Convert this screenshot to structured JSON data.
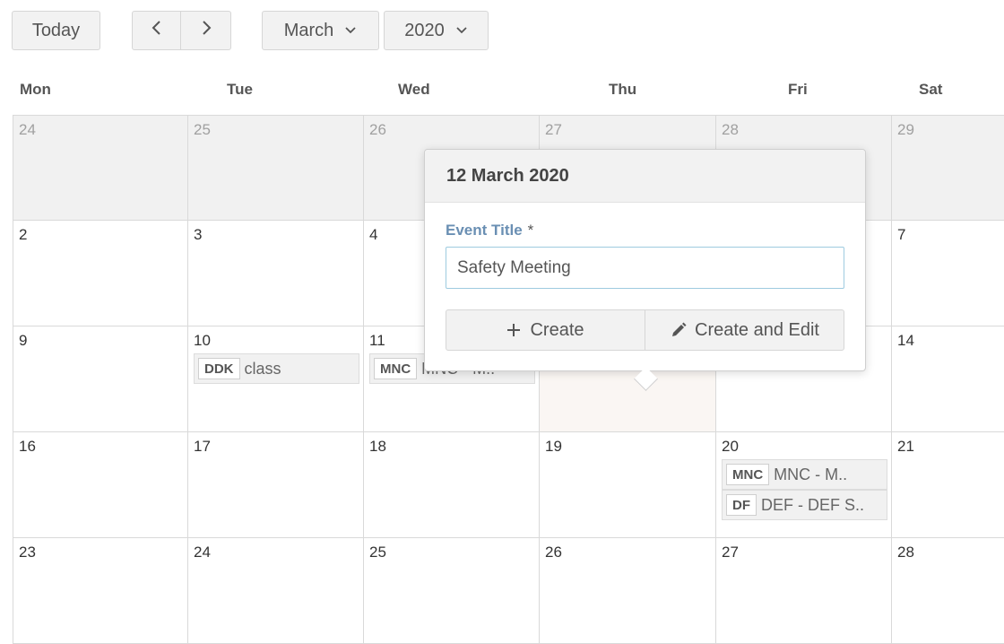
{
  "toolbar": {
    "today_label": "Today",
    "month_label": "March",
    "year_label": "2020",
    "prev_icon": "chevron-left-icon",
    "next_icon": "chevron-right-icon"
  },
  "weekdays": [
    "Mon",
    "Tue",
    "Wed",
    "Thu",
    "Fri",
    "Sat"
  ],
  "weeks": [
    {
      "days": [
        {
          "num": "24",
          "out": true,
          "events": []
        },
        {
          "num": "25",
          "out": true,
          "events": []
        },
        {
          "num": "26",
          "out": true,
          "events": []
        },
        {
          "num": "27",
          "out": true,
          "events": []
        },
        {
          "num": "28",
          "out": true,
          "events": []
        },
        {
          "num": "29",
          "out": true,
          "events": []
        }
      ]
    },
    {
      "days": [
        {
          "num": "2",
          "events": []
        },
        {
          "num": "3",
          "events": []
        },
        {
          "num": "4",
          "events": []
        },
        {
          "num": "",
          "events": []
        },
        {
          "num": "",
          "events": []
        },
        {
          "num": "7",
          "events": []
        }
      ]
    },
    {
      "days": [
        {
          "num": "9",
          "events": []
        },
        {
          "num": "10",
          "events": [
            {
              "badge": "DDK",
              "text": "class"
            }
          ]
        },
        {
          "num": "11",
          "events": [
            {
              "badge": "MNC",
              "text": "MNC - M.."
            }
          ]
        },
        {
          "num": "",
          "today": true,
          "events": []
        },
        {
          "num": "",
          "events": []
        },
        {
          "num": "14",
          "events": []
        }
      ]
    },
    {
      "days": [
        {
          "num": "16",
          "events": []
        },
        {
          "num": "17",
          "events": []
        },
        {
          "num": "18",
          "events": []
        },
        {
          "num": "19",
          "events": []
        },
        {
          "num": "20",
          "events": [
            {
              "badge": "MNC",
              "text": "MNC - M.."
            },
            {
              "badge": "DF",
              "text": "DEF - DEF S.."
            }
          ]
        },
        {
          "num": "21",
          "events": []
        }
      ]
    },
    {
      "days": [
        {
          "num": "23",
          "events": []
        },
        {
          "num": "24",
          "events": []
        },
        {
          "num": "25",
          "events": []
        },
        {
          "num": "26",
          "events": []
        },
        {
          "num": "27",
          "events": []
        },
        {
          "num": "28",
          "events": []
        }
      ]
    }
  ],
  "popover": {
    "date_title": "12 March 2020",
    "field_label": "Event Title",
    "required_mark": "*",
    "title_value": "Safety Meeting",
    "create_label": "Create",
    "create_edit_label": "Create and Edit",
    "create_icon": "plus-icon",
    "create_edit_icon": "pencil-icon"
  }
}
